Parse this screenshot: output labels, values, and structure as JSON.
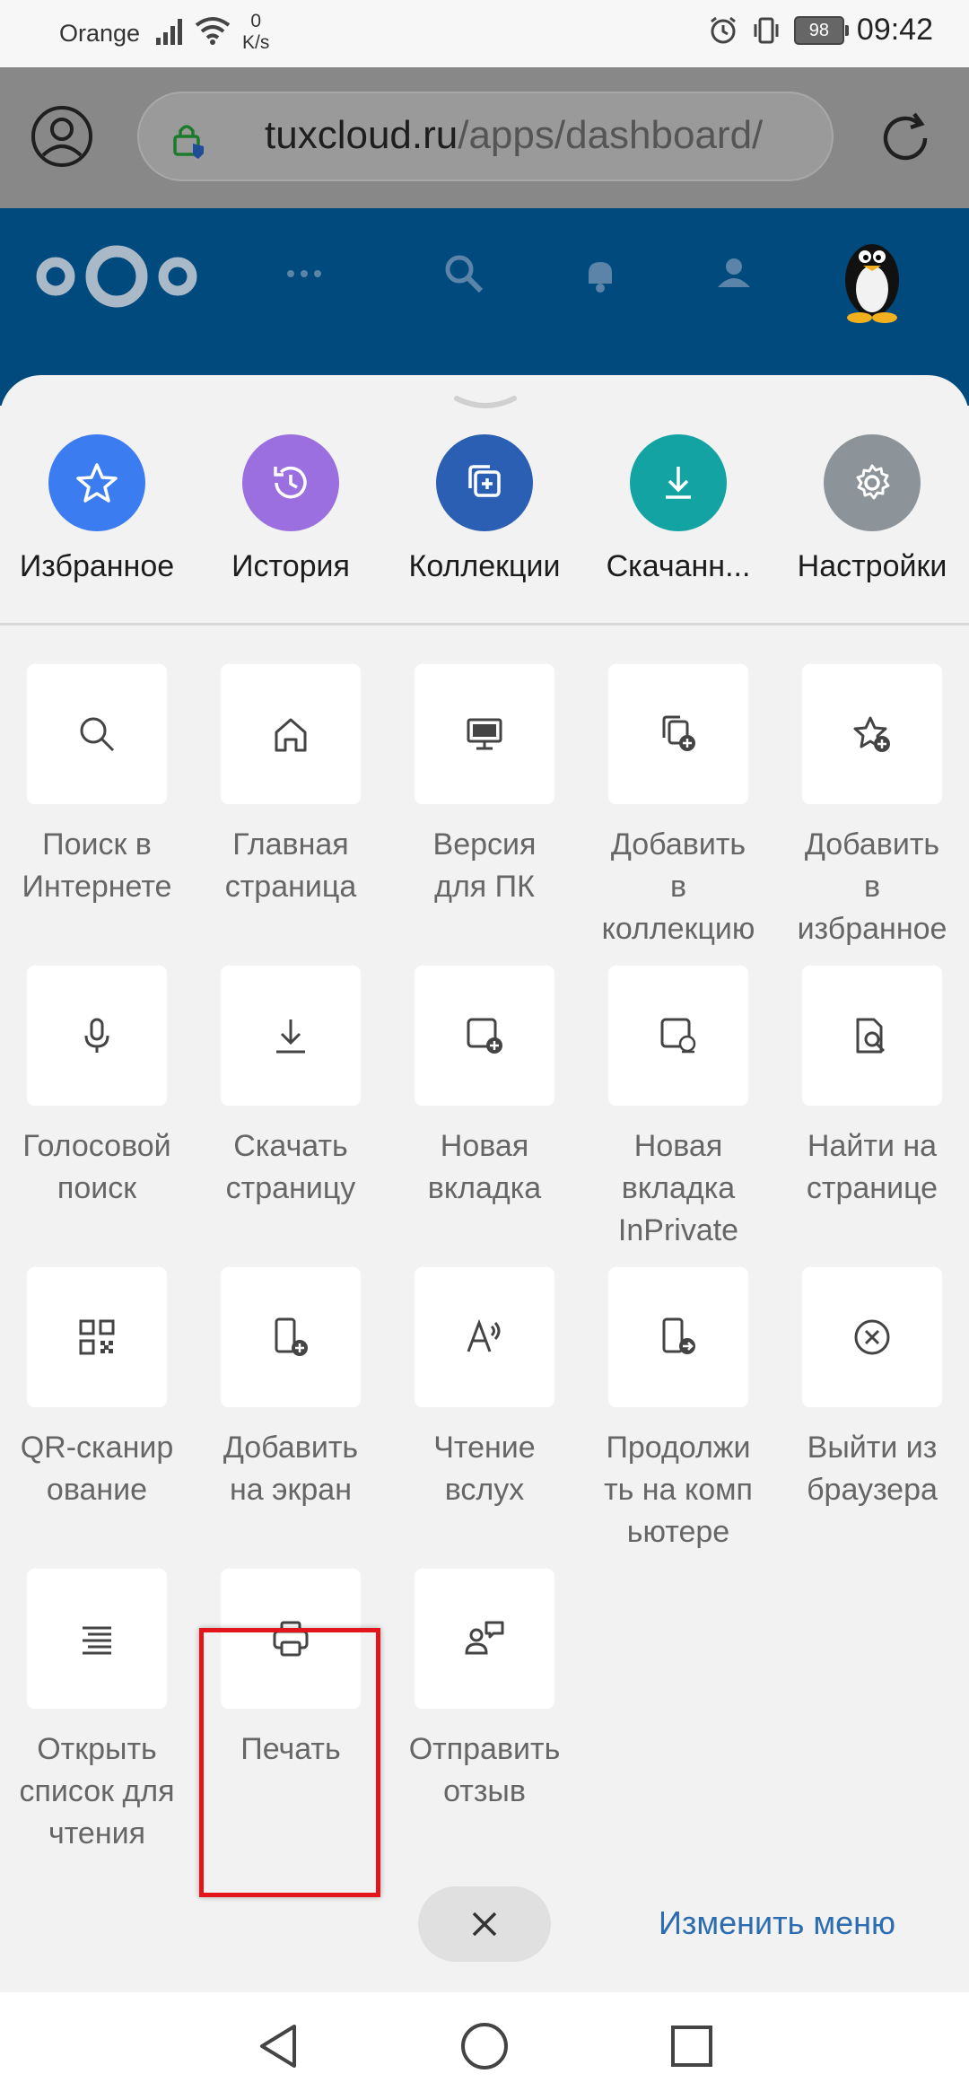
{
  "status_bar": {
    "carrier": "Orange",
    "speed_value": "0",
    "speed_unit": "K/s",
    "battery": "98",
    "time": "09:42"
  },
  "browser": {
    "url_host": "tuxcloud.ru",
    "url_path": "/apps/dashboard/"
  },
  "quick_actions": [
    {
      "label": "Избранное",
      "icon": "star-icon",
      "color": "#3b7cf0"
    },
    {
      "label": "История",
      "icon": "history-icon",
      "color": "#9b6fe0"
    },
    {
      "label": "Коллекции",
      "icon": "collections-icon",
      "color": "#2a5fb4"
    },
    {
      "label": "Скачанн...",
      "icon": "download-icon",
      "color": "#13a3a3"
    },
    {
      "label": "Настройки",
      "icon": "gear-icon",
      "color": "#8c9399"
    }
  ],
  "menu_items": [
    {
      "label": "Поиск в\nИнтернете",
      "icon": "search-icon"
    },
    {
      "label": "Главная\nстраница",
      "icon": "home-icon"
    },
    {
      "label": "Версия\nдля ПК",
      "icon": "desktop-icon"
    },
    {
      "label": "Добавить\nв\nколлекцию",
      "icon": "add-collection-icon"
    },
    {
      "label": "Добавить\nв\nизбранное",
      "icon": "add-favorite-icon"
    },
    {
      "label": "Голосовой\nпоиск",
      "icon": "microphone-icon"
    },
    {
      "label": "Скачать\nстраницу",
      "icon": "download-icon"
    },
    {
      "label": "Новая\nвкладка",
      "icon": "new-tab-icon"
    },
    {
      "label": "Новая\nвкладка\nInPrivate",
      "icon": "inprivate-tab-icon"
    },
    {
      "label": "Найти на\nстранице",
      "icon": "find-on-page-icon"
    },
    {
      "label": "QR-сканир\nование",
      "icon": "qr-icon"
    },
    {
      "label": "Добавить\nна экран",
      "icon": "add-to-screen-icon"
    },
    {
      "label": "Чтение\nвслух",
      "icon": "read-aloud-icon"
    },
    {
      "label": "Продолжи\nть на комп\nьютере",
      "icon": "continue-on-pc-icon"
    },
    {
      "label": "Выйти из\nбраузера",
      "icon": "exit-icon"
    },
    {
      "label": "Открыть\nсписок для\nчтения",
      "icon": "reading-list-icon"
    },
    {
      "label": "Печать",
      "icon": "print-icon"
    },
    {
      "label": "Отправить\nотзыв",
      "icon": "feedback-icon"
    }
  ],
  "footer": {
    "edit_menu": "Изменить меню"
  },
  "colors": {
    "nextcloud_header": "#004a7e",
    "highlight": "#e3151a",
    "link": "#2c6db1"
  }
}
